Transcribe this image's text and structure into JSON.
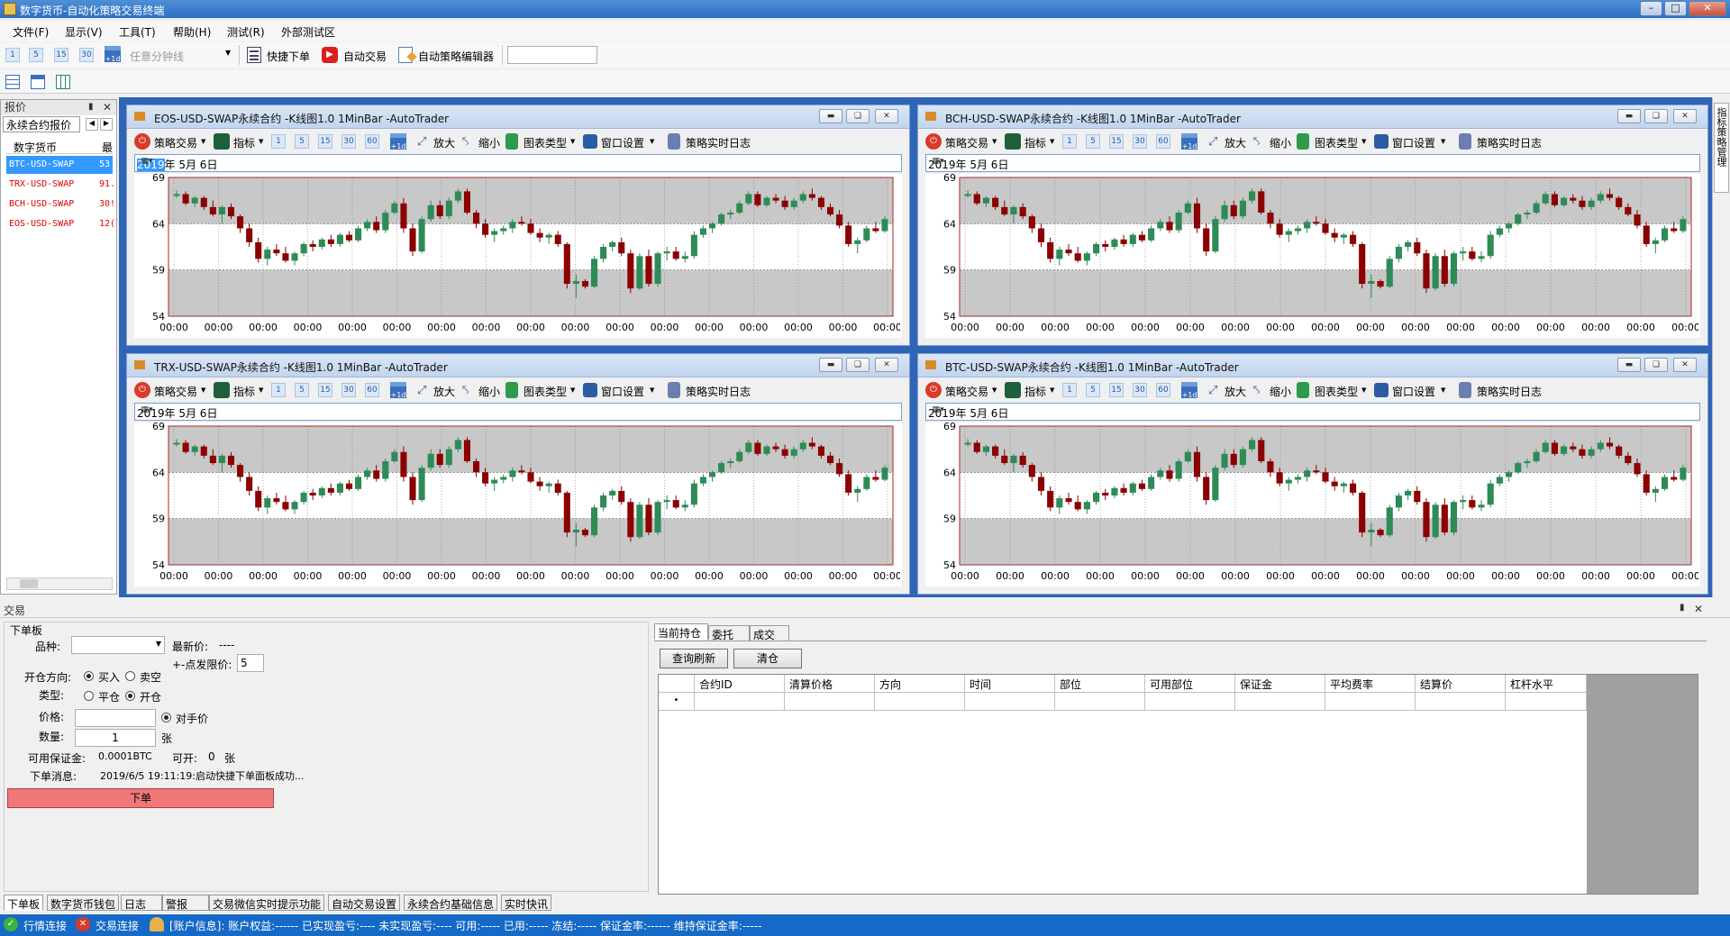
{
  "window": {
    "title": "数字货币-自动化策略交易终端"
  },
  "menu": [
    "文件(F)",
    "显示(V)",
    "工具(T)",
    "帮助(H)",
    "测试(R)",
    "外部测试区"
  ],
  "toolbar": {
    "periods": [
      "1",
      "5",
      "15",
      "30"
    ],
    "cal_label": "+1d",
    "minute_placeholder": "任意分钟线",
    "quick_order": "快捷下单",
    "auto_trade": "自动交易",
    "strategy_editor": "自动策略编辑器"
  },
  "left_panel": {
    "header": "报价",
    "tab": "永续合约报价",
    "col_name": "数字货币",
    "col_price": "最",
    "rows": [
      {
        "name": "BTC-USD-SWAP",
        "price": "53"
      },
      {
        "name": "TRX-USD-SWAP",
        "price": "91."
      },
      {
        "name": "BCH-USD-SWAP",
        "price": "30!"
      },
      {
        "name": "EOS-USD-SWAP",
        "price": "12("
      }
    ]
  },
  "chart_toolbar": {
    "strategy": "策略交易",
    "indicator": "指标",
    "periods": [
      "1",
      "5",
      "15",
      "30",
      "60"
    ],
    "zoom_in": "放大",
    "zoom_out": "缩小",
    "chart_type": "图表类型",
    "window_settings": "窗口设置",
    "log": "策略实时日志",
    "date": "2019年  5月  6日",
    "date_year": "2019",
    "date_rest": "年  5月  6日"
  },
  "chart_windows": [
    {
      "title": "EOS-USD-SWAP永续合约 -K线图1.0 1MinBar -AutoTrader"
    },
    {
      "title": "BCH-USD-SWAP永续合约 -K线图1.0 1MinBar -AutoTrader"
    },
    {
      "title": "TRX-USD-SWAP永续合约 -K线图1.0 1MinBar -AutoTrader"
    },
    {
      "title": "BTC-USD-SWAP永续合约 -K线图1.0 1MinBar -AutoTrader"
    }
  ],
  "chart_data": {
    "type": "candlestick",
    "y_ticks": [
      69,
      64,
      59,
      54
    ],
    "ylim": [
      54,
      69
    ],
    "x_tick_label": "00:00",
    "x_tick_count": 17,
    "candles": [
      [
        67.0,
        67.6,
        66.8,
        67.2
      ],
      [
        67.2,
        67.5,
        66.0,
        66.2
      ],
      [
        66.2,
        67.0,
        65.8,
        66.8
      ],
      [
        66.8,
        67.0,
        65.5,
        65.8
      ],
      [
        65.8,
        66.5,
        64.8,
        65.0
      ],
      [
        65.0,
        66.0,
        64.0,
        65.8
      ],
      [
        65.8,
        66.2,
        64.5,
        64.8
      ],
      [
        64.8,
        65.0,
        63.0,
        63.5
      ],
      [
        63.5,
        64.0,
        61.5,
        62.0
      ],
      [
        62.0,
        62.5,
        59.8,
        60.2
      ],
      [
        60.2,
        61.5,
        59.5,
        61.2
      ],
      [
        61.2,
        61.8,
        60.5,
        60.8
      ],
      [
        60.8,
        61.5,
        59.8,
        60.0
      ],
      [
        60.0,
        61.0,
        59.5,
        60.8
      ],
      [
        60.8,
        62.0,
        60.5,
        61.8
      ],
      [
        61.8,
        62.2,
        61.0,
        61.5
      ],
      [
        61.5,
        62.5,
        61.2,
        62.3
      ],
      [
        62.3,
        62.8,
        61.5,
        61.8
      ],
      [
        61.8,
        63.0,
        61.5,
        62.8
      ],
      [
        62.8,
        63.2,
        62.0,
        62.2
      ],
      [
        62.2,
        63.8,
        62.0,
        63.5
      ],
      [
        63.5,
        64.5,
        63.2,
        64.2
      ],
      [
        64.2,
        64.8,
        63.0,
        63.3
      ],
      [
        63.3,
        65.5,
        63.0,
        65.2
      ],
      [
        65.2,
        66.5,
        65.0,
        66.2
      ],
      [
        66.2,
        66.8,
        63.0,
        63.5
      ],
      [
        63.5,
        64.0,
        60.5,
        61.0
      ],
      [
        61.0,
        64.8,
        60.8,
        64.5
      ],
      [
        64.5,
        66.5,
        64.2,
        66.0
      ],
      [
        66.0,
        66.5,
        64.5,
        64.8
      ],
      [
        64.8,
        66.8,
        64.5,
        66.5
      ],
      [
        66.5,
        67.8,
        66.2,
        67.5
      ],
      [
        67.5,
        67.8,
        65.0,
        65.2
      ],
      [
        65.2,
        65.5,
        63.5,
        64.0
      ],
      [
        64.0,
        64.5,
        62.5,
        62.8
      ],
      [
        62.8,
        63.5,
        62.0,
        63.2
      ],
      [
        63.2,
        63.8,
        62.8,
        63.5
      ],
      [
        63.5,
        64.5,
        63.0,
        64.2
      ],
      [
        64.2,
        64.8,
        63.8,
        64.0
      ],
      [
        64.0,
        64.5,
        62.8,
        63.0
      ],
      [
        63.0,
        63.5,
        62.0,
        62.5
      ],
      [
        62.5,
        63.0,
        61.8,
        62.8
      ],
      [
        62.8,
        63.2,
        61.5,
        61.8
      ],
      [
        61.8,
        62.0,
        57.0,
        57.5
      ],
      [
        57.5,
        58.5,
        56.0,
        57.8
      ],
      [
        57.8,
        58.0,
        57.0,
        57.2
      ],
      [
        57.2,
        60.5,
        57.0,
        60.2
      ],
      [
        60.2,
        61.8,
        59.8,
        61.5
      ],
      [
        61.5,
        62.2,
        61.0,
        62.0
      ],
      [
        62.0,
        62.5,
        60.5,
        60.8
      ],
      [
        60.8,
        61.2,
        56.5,
        57.0
      ],
      [
        57.0,
        60.8,
        56.8,
        60.5
      ],
      [
        60.5,
        61.2,
        57.2,
        57.5
      ],
      [
        57.5,
        61.0,
        57.2,
        60.8
      ],
      [
        60.8,
        61.5,
        60.0,
        61.0
      ],
      [
        61.0,
        61.5,
        60.0,
        60.2
      ],
      [
        60.2,
        61.0,
        59.8,
        60.5
      ],
      [
        60.5,
        63.2,
        60.2,
        62.8
      ],
      [
        62.8,
        63.8,
        62.5,
        63.5
      ],
      [
        63.5,
        64.2,
        63.0,
        64.0
      ],
      [
        64.0,
        65.2,
        63.8,
        65.0
      ],
      [
        65.0,
        65.5,
        64.5,
        65.2
      ],
      [
        65.2,
        66.5,
        65.0,
        66.2
      ],
      [
        66.2,
        67.5,
        66.0,
        67.2
      ],
      [
        67.2,
        67.5,
        65.8,
        66.0
      ],
      [
        66.0,
        67.0,
        65.8,
        66.8
      ],
      [
        66.8,
        67.2,
        66.2,
        66.5
      ],
      [
        66.5,
        67.0,
        65.5,
        65.8
      ],
      [
        65.8,
        66.8,
        65.5,
        66.5
      ],
      [
        66.5,
        67.5,
        66.2,
        67.2
      ],
      [
        67.2,
        67.8,
        66.5,
        66.8
      ],
      [
        66.8,
        67.0,
        65.5,
        65.8
      ],
      [
        65.8,
        66.2,
        64.8,
        65.0
      ],
      [
        65.0,
        65.5,
        63.5,
        63.8
      ],
      [
        63.8,
        64.2,
        61.5,
        61.8
      ],
      [
        61.8,
        62.5,
        60.8,
        62.2
      ],
      [
        62.2,
        63.8,
        62.0,
        63.5
      ],
      [
        63.5,
        64.2,
        63.0,
        63.2
      ],
      [
        63.2,
        64.8,
        63.0,
        64.5
      ]
    ]
  },
  "trade_panel": {
    "header": "交易",
    "group": "下单板",
    "symbol_label": "品种:",
    "latest_label": "最新价:",
    "latest_value": "----",
    "offset_label": "+-点发限价:",
    "offset_value": "5",
    "direction_label": "开仓方向:",
    "buy": "买入",
    "sell": "卖空",
    "type_label": "类型:",
    "close": "平仓",
    "open": "开仓",
    "price_label": "价格:",
    "counter_price": "对手价",
    "qty_label": "数量:",
    "qty_value": "1",
    "qty_unit": "张",
    "margin_label": "可用保证金:",
    "margin_value": "0.0001BTC",
    "openable_label": "可开:",
    "openable_value": "0",
    "openable_unit": "张",
    "msg_label": "下单消息:",
    "msg_value": "2019/6/5 19:11:19:启动快捷下单面板成功...",
    "submit": "下单"
  },
  "positions": {
    "tabs": [
      "当前持仓",
      "委托",
      "成交"
    ],
    "refresh": "查询刷新",
    "clear": "清仓",
    "columns": [
      "合约ID",
      "清算价格",
      "方向",
      "时间",
      "部位",
      "可用部位",
      "保证金",
      "平均费率",
      "结算价",
      "杠杆水平"
    ],
    "row_marker": "•"
  },
  "bottom_tabs": [
    "下单板",
    "数字货币钱包",
    "日志",
    "警报",
    "交易微信实时提示功能",
    "自动交易设置",
    "永续合约基础信息",
    "实时快讯"
  ],
  "right_strip": "指标策略管理",
  "status": {
    "market": "行情连接",
    "trade": "交易连接",
    "account": "[账户信息]: 账户权益:------ 已实现盈亏:---- 未实现盈亏:---- 可用:----- 已用:----- 冻结:----- 保证金率:------ 维持保证金率:-----"
  },
  "colors": {
    "up": "#2e8b57",
    "down": "#8b0000",
    "accent": "#1569c7",
    "submit_bg": "#f07878"
  }
}
